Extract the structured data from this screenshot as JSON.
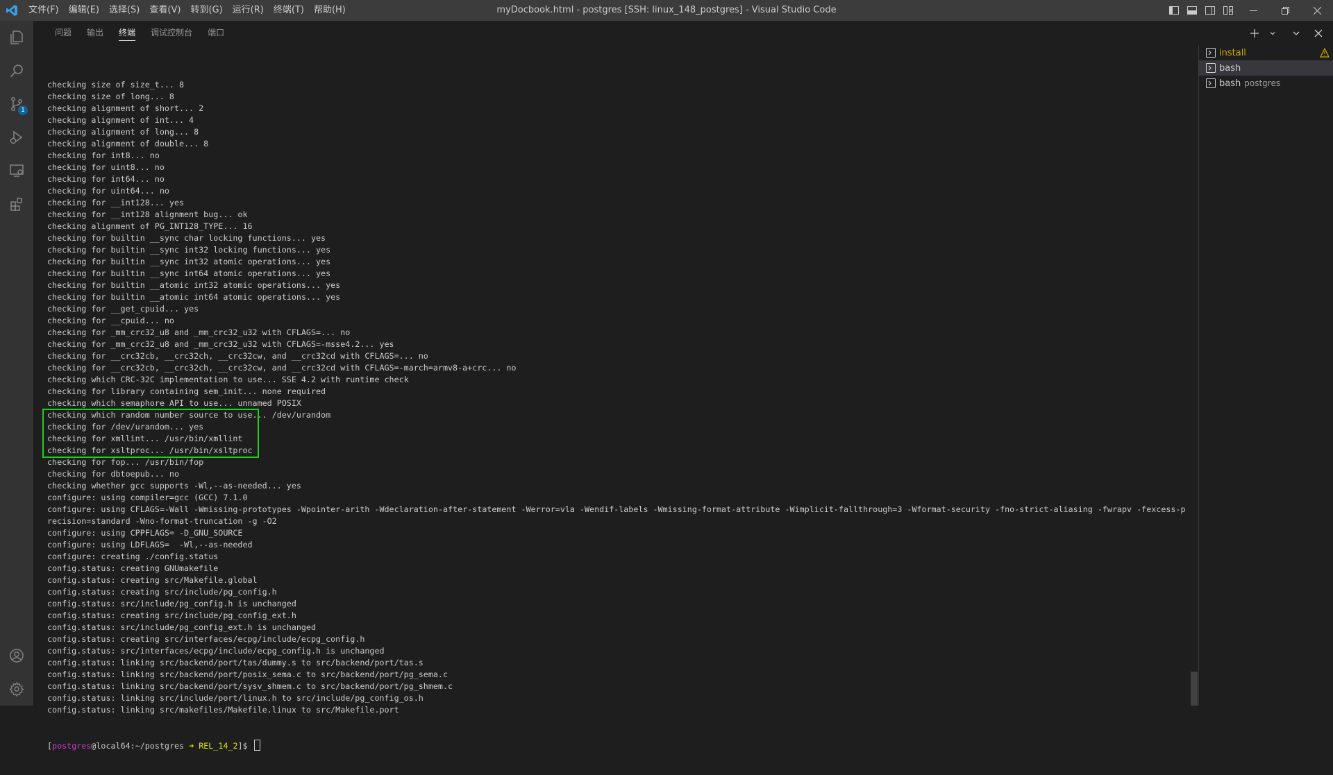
{
  "app": {
    "title": "myDocbook.html - postgres [SSH: linux_148_postgres] - Visual Studio Code",
    "menu": [
      "文件(F)",
      "编辑(E)",
      "选择(S)",
      "查看(V)",
      "转到(G)",
      "运行(R)",
      "终端(T)",
      "帮助(H)"
    ],
    "source_control_badge": "1"
  },
  "panel": {
    "tabs": [
      {
        "label": "问题",
        "active": false
      },
      {
        "label": "输出",
        "active": false
      },
      {
        "label": "终端",
        "active": true
      },
      {
        "label": "调试控制台",
        "active": false
      },
      {
        "label": "端口",
        "active": false
      }
    ]
  },
  "terminal": {
    "lines": [
      "checking size of size_t... 8",
      "checking size of long... 8",
      "checking alignment of short... 2",
      "checking alignment of int... 4",
      "checking alignment of long... 8",
      "checking alignment of double... 8",
      "checking for int8... no",
      "checking for uint8... no",
      "checking for int64... no",
      "checking for uint64... no",
      "checking for __int128... yes",
      "checking for __int128 alignment bug... ok",
      "checking alignment of PG_INT128_TYPE... 16",
      "checking for builtin __sync char locking functions... yes",
      "checking for builtin __sync int32 locking functions... yes",
      "checking for builtin __sync int32 atomic operations... yes",
      "checking for builtin __sync int64 atomic operations... yes",
      "checking for builtin __atomic int32 atomic operations... yes",
      "checking for builtin __atomic int64 atomic operations... yes",
      "checking for __get_cpuid... yes",
      "checking for __cpuid... no",
      "checking for _mm_crc32_u8 and _mm_crc32_u32 with CFLAGS=... no",
      "checking for _mm_crc32_u8 and _mm_crc32_u32 with CFLAGS=-msse4.2... yes",
      "checking for __crc32cb, __crc32ch, __crc32cw, and __crc32cd with CFLAGS=... no",
      "checking for __crc32cb, __crc32ch, __crc32cw, and __crc32cd with CFLAGS=-march=armv8-a+crc... no",
      "checking which CRC-32C implementation to use... SSE 4.2 with runtime check",
      "checking for library containing sem_init... none required",
      "checking which semaphore API to use... unnamed POSIX",
      "checking which random number source to use... /dev/urandom",
      "checking for /dev/urandom... yes",
      "checking for xmllint... /usr/bin/xmllint",
      "checking for xsltproc... /usr/bin/xsltproc",
      "checking for fop... /usr/bin/fop",
      "checking for dbtoepub... no",
      "checking whether gcc supports -Wl,--as-needed... yes",
      "configure: using compiler=gcc (GCC) 7.1.0",
      "configure: using CFLAGS=-Wall -Wmissing-prototypes -Wpointer-arith -Wdeclaration-after-statement -Werror=vla -Wendif-labels -Wmissing-format-attribute -Wimplicit-fallthrough=3 -Wformat-security -fno-strict-aliasing -fwrapv -fexcess-p",
      "recision=standard -Wno-format-truncation -g -O2",
      "configure: using CPPFLAGS= -D_GNU_SOURCE",
      "configure: using LDFLAGS=  -Wl,--as-needed",
      "configure: creating ./config.status",
      "config.status: creating GNUmakefile",
      "config.status: creating src/Makefile.global",
      "config.status: creating src/include/pg_config.h",
      "config.status: src/include/pg_config.h is unchanged",
      "config.status: creating src/include/pg_config_ext.h",
      "config.status: src/include/pg_config_ext.h is unchanged",
      "config.status: creating src/interfaces/ecpg/include/ecpg_config.h",
      "config.status: src/interfaces/ecpg/include/ecpg_config.h is unchanged",
      "config.status: linking src/backend/port/tas/dummy.s to src/backend/port/tas.s",
      "config.status: linking src/backend/port/posix_sema.c to src/backend/port/pg_sema.c",
      "config.status: linking src/backend/port/sysv_shmem.c to src/backend/port/pg_shmem.c",
      "config.status: linking src/include/port/linux.h to src/include/pg_config_os.h",
      "config.status: linking src/makefiles/Makefile.linux to src/Makefile.port"
    ],
    "prompt": {
      "open": "[",
      "user": "postgres",
      "at": "@",
      "host": "local64",
      "path": ":~/postgres",
      "arrow": " ➜ ",
      "branch": "REL_14_2",
      "close": "]$ "
    }
  },
  "terminal_list": [
    {
      "label": "install",
      "description": "",
      "warning": true,
      "selected": false
    },
    {
      "label": "bash",
      "description": "",
      "warning": false,
      "selected": true
    },
    {
      "label": "bash",
      "description": "postgres",
      "warning": false,
      "selected": false
    }
  ],
  "colors": {
    "highlight_box": "#22cc22",
    "warning": "#cca700",
    "prompt_user": "#cd3bcd",
    "prompt_branch": "#e5e510"
  }
}
